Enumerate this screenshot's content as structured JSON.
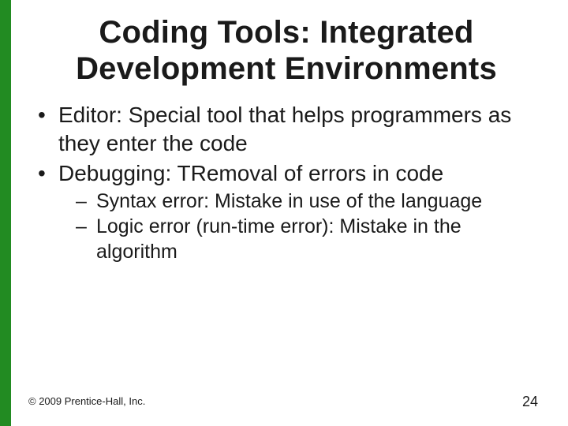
{
  "title": "Coding Tools: Integrated Development Environments",
  "bullets": [
    {
      "text": "Editor:  Special tool that helps programmers as they enter the code"
    },
    {
      "text": "Debugging: TRemoval of errors in code",
      "sub": [
        "Syntax error: Mistake in use of the language",
        "Logic error (run-time error): Mistake in the algorithm"
      ]
    }
  ],
  "footer": "© 2009 Prentice-Hall, Inc.",
  "page_number": "24"
}
